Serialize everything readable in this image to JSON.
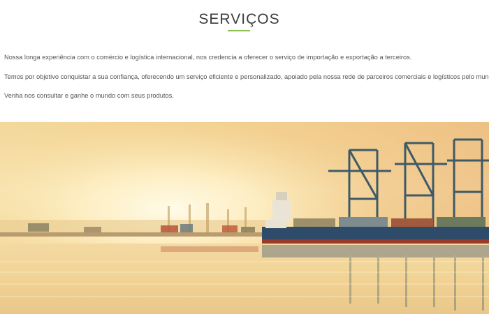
{
  "section": {
    "title": "SERVIÇOS",
    "accent_color": "#8cc152"
  },
  "paragraphs": [
    "Nossa longa experiência com o comércio e logística internacional, nos credencia a oferecer o serviço de importação e exportação a terceiros.",
    "Temos por objetivo conquistar a sua confiança, oferecendo um serviço eficiente e personalizado, apoiado pela nossa rede de parceiros comerciais e logísticos pelo mundo.",
    "Venha nos consultar e ganhe o mundo com seus produtos."
  ],
  "hero_image": {
    "subject": "cargo-port-with-container-ship-and-cranes-at-sunset"
  }
}
